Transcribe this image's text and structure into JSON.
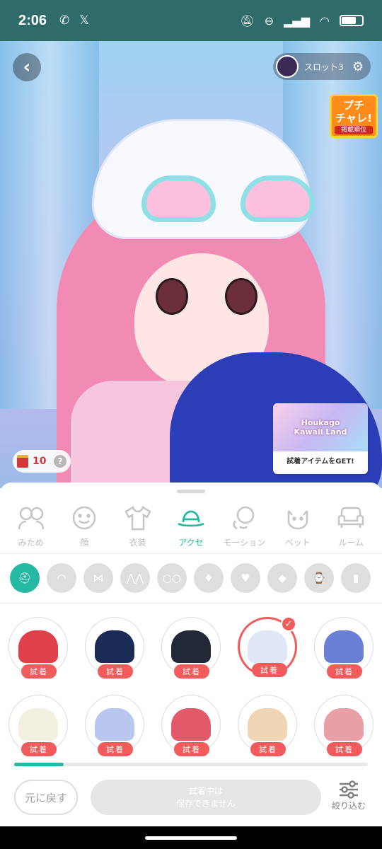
{
  "status_bar": {
    "time": "2:06",
    "battery_level": 0.65
  },
  "top": {
    "slot_label": "スロット3"
  },
  "badge": {
    "title_line1": "プチ",
    "title_line2": "チャレ!",
    "subtitle": "掲載順位"
  },
  "promo": {
    "art_line1": "Houkago",
    "art_line2": "Kawaii Land",
    "label": "試着アイテムをGET!"
  },
  "currency": {
    "count": "10",
    "help": "?"
  },
  "categories": [
    {
      "label": "みため",
      "icon": "people-icon"
    },
    {
      "label": "顔",
      "icon": "face-icon"
    },
    {
      "label": "衣装",
      "icon": "shirt-icon"
    },
    {
      "label": "アクセ",
      "icon": "hat-icon",
      "active": true
    },
    {
      "label": "モーション",
      "icon": "motion-icon"
    },
    {
      "label": "ペット",
      "icon": "cat-icon"
    },
    {
      "label": "ルーム",
      "icon": "sofa-icon"
    }
  ],
  "subcategories": [
    "hat-icon",
    "headband-icon",
    "ribbon-icon",
    "ears-icon",
    "glasses-icon",
    "earring-icon",
    "necklace-icon",
    "gem-icon",
    "watch-icon",
    "nail-icon"
  ],
  "items": [
    {
      "name": "headphone-rabbit",
      "try_label": "試着",
      "color": "#e0404a",
      "selected": false
    },
    {
      "name": "halo-crown",
      "try_label": "試着",
      "color": "#1a2b55",
      "selected": false
    },
    {
      "name": "captain-hat",
      "try_label": "試着",
      "color": "#222838",
      "selected": false
    },
    {
      "name": "bear-hood",
      "try_label": "試着",
      "color": "#dfe6f5",
      "selected": true
    },
    {
      "name": "shark-cap",
      "try_label": "試着",
      "color": "#6a7fd6",
      "selected": false
    },
    {
      "name": "bear-beret",
      "try_label": "試着",
      "color": "#f4f0e0",
      "selected": false
    },
    {
      "name": "lace-bonnet",
      "try_label": "試着",
      "color": "#b9c6ef",
      "selected": false
    },
    {
      "name": "strawberry-cake-hat",
      "try_label": "試着",
      "color": "#e25a6a",
      "selected": false
    },
    {
      "name": "straw-boater",
      "try_label": "試着",
      "color": "#f1d6b5",
      "selected": false
    },
    {
      "name": "crab-beret",
      "try_label": "試着",
      "color": "#e8a0a6",
      "selected": false
    }
  ],
  "scroll_progress": 0.14,
  "actions": {
    "reset_label": "元に戻す",
    "save_line1": "試着中は",
    "save_line2": "保存できません",
    "filter_label": "絞り込む"
  },
  "colors": {
    "accent": "#25b8a3",
    "try": "#f15b5b",
    "status_bar": "#2e6b6a"
  }
}
